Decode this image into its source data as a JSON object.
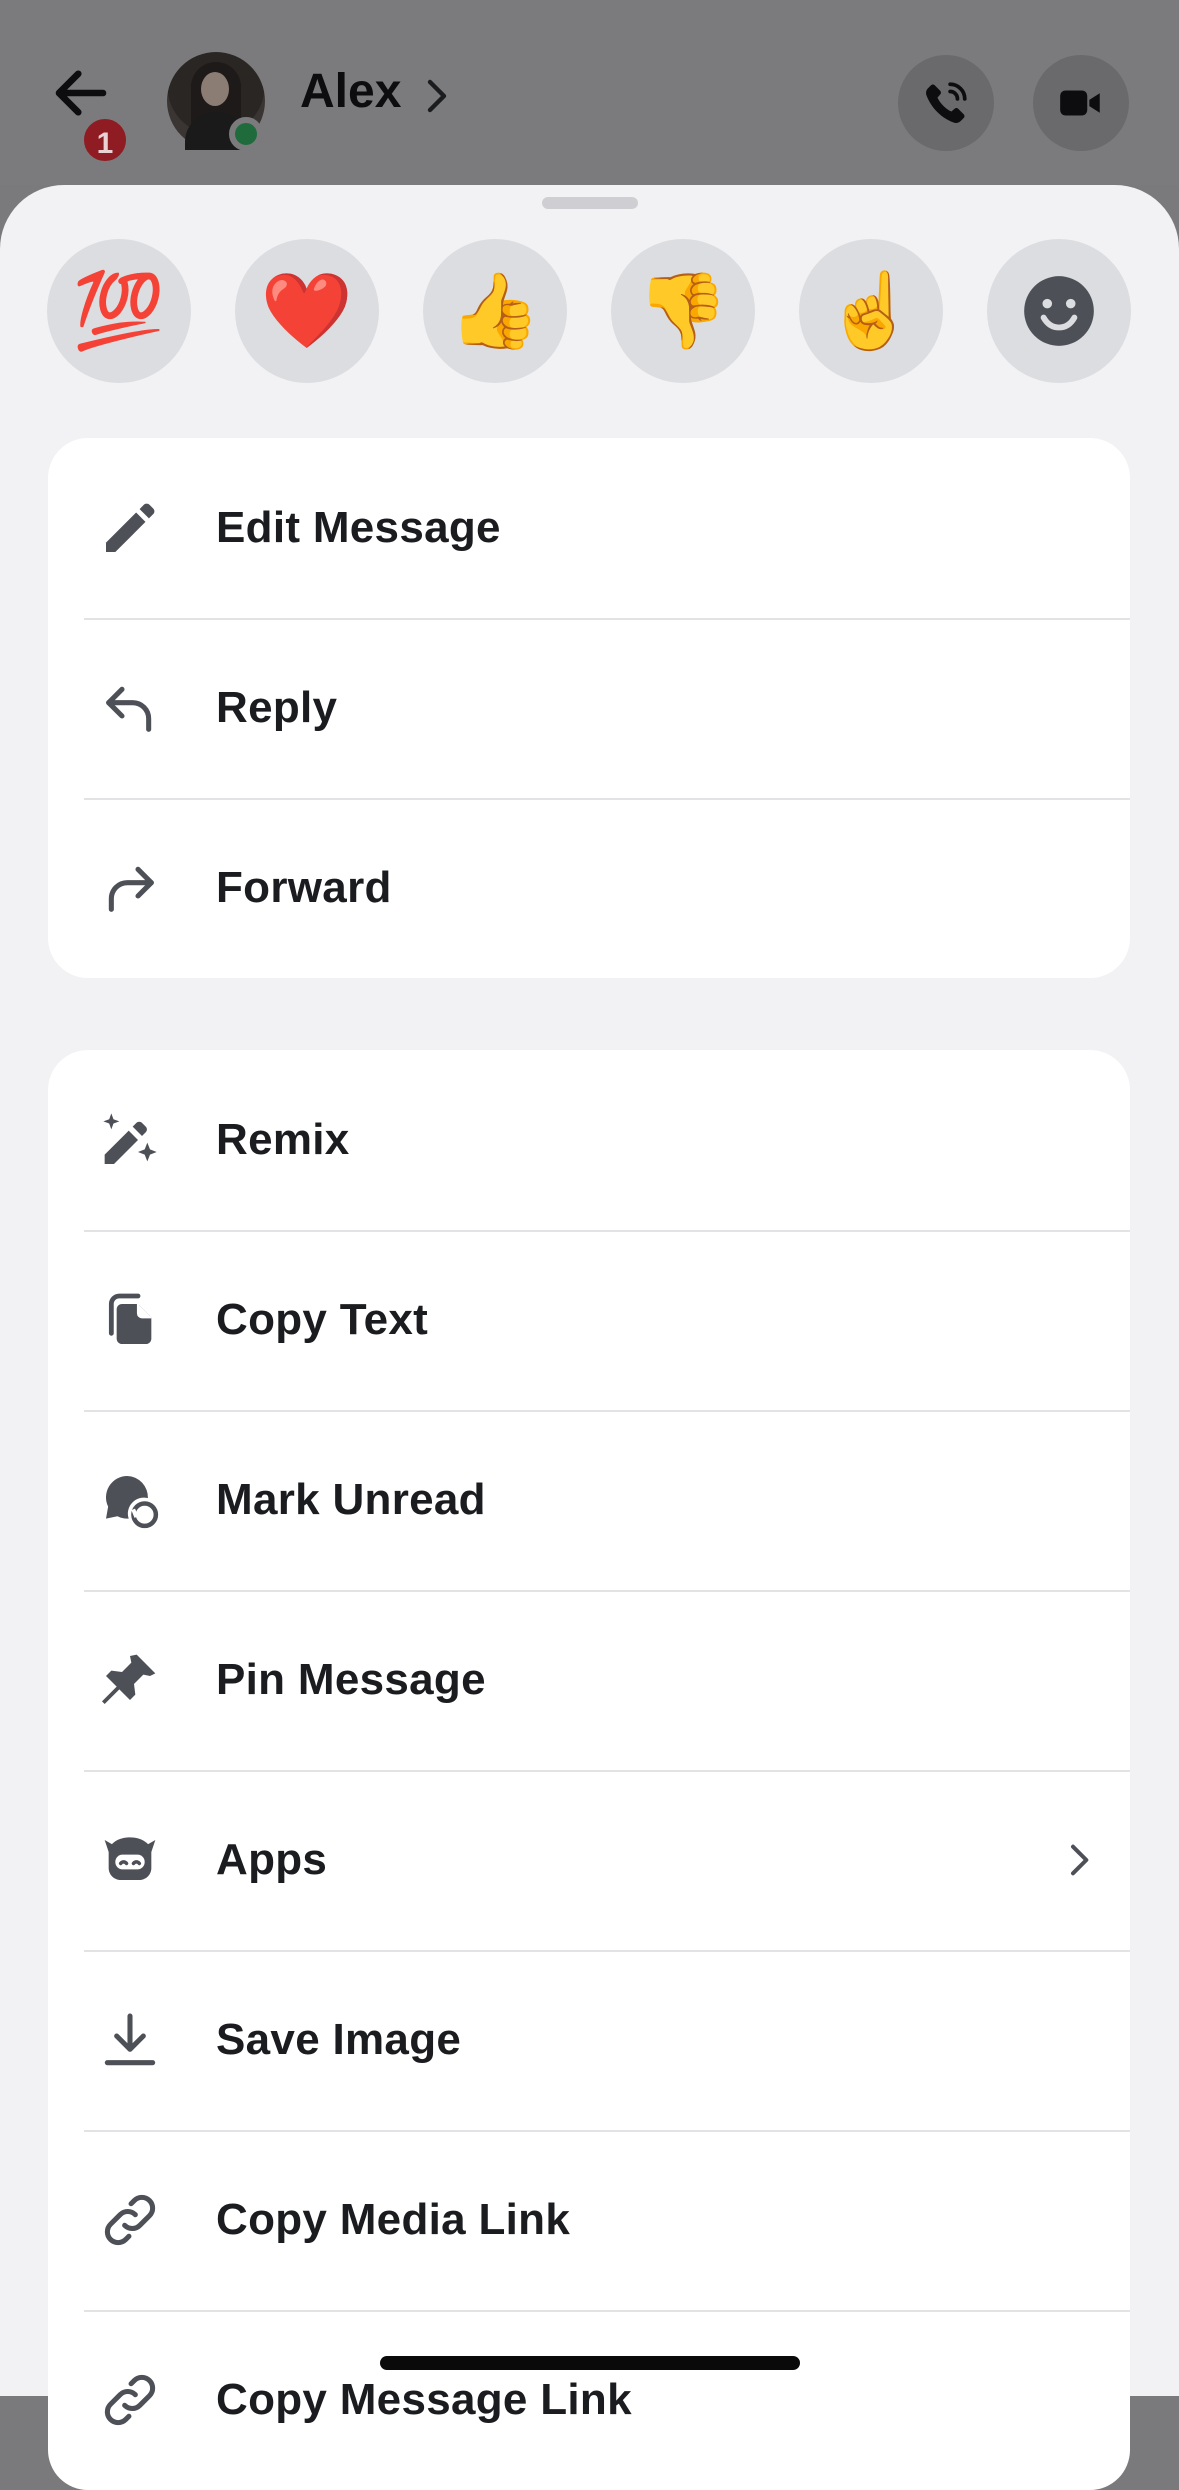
{
  "header": {
    "contact_name": "Alex",
    "unread_badge": "1",
    "icons": [
      "back-arrow-icon",
      "chevron-right-icon",
      "phone-call-icon",
      "video-camera-icon"
    ]
  },
  "reactions": [
    {
      "emoji": "💯",
      "name": "hundred-points-emoji"
    },
    {
      "emoji": "❤️",
      "name": "red-heart-emoji"
    },
    {
      "emoji": "👍",
      "name": "thumbs-up-emoji"
    },
    {
      "emoji": "👎",
      "name": "thumbs-down-emoji"
    },
    {
      "emoji": "☝️",
      "name": "index-pointing-up-emoji"
    },
    {
      "emoji": "",
      "name": "add-reaction-icon"
    }
  ],
  "menu_primary": [
    {
      "label": "Edit Message",
      "icon": "pencil-icon"
    },
    {
      "label": "Reply",
      "icon": "reply-arrow-icon"
    },
    {
      "label": "Forward",
      "icon": "forward-arrow-icon"
    }
  ],
  "menu_secondary": [
    {
      "label": "Remix",
      "icon": "magic-pencil-icon"
    },
    {
      "label": "Copy Text",
      "icon": "copy-icon"
    },
    {
      "label": "Mark Unread",
      "icon": "mark-unread-icon"
    },
    {
      "label": "Pin Message",
      "icon": "pin-icon"
    },
    {
      "label": "Apps",
      "icon": "apps-bot-icon",
      "has_submenu": true
    },
    {
      "label": "Save Image",
      "icon": "download-icon"
    },
    {
      "label": "Copy Media Link",
      "icon": "link-icon"
    },
    {
      "label": "Copy Message Link",
      "icon": "link-icon"
    }
  ],
  "colors": {
    "sheet_background": "#f2f2f4",
    "card_background": "#ffffff",
    "reaction_bubble": "#dcdde0",
    "text": "#1b1c1f",
    "icon": "#4e5058",
    "badge": "#8e1c22",
    "online": "#1f6b3c"
  }
}
